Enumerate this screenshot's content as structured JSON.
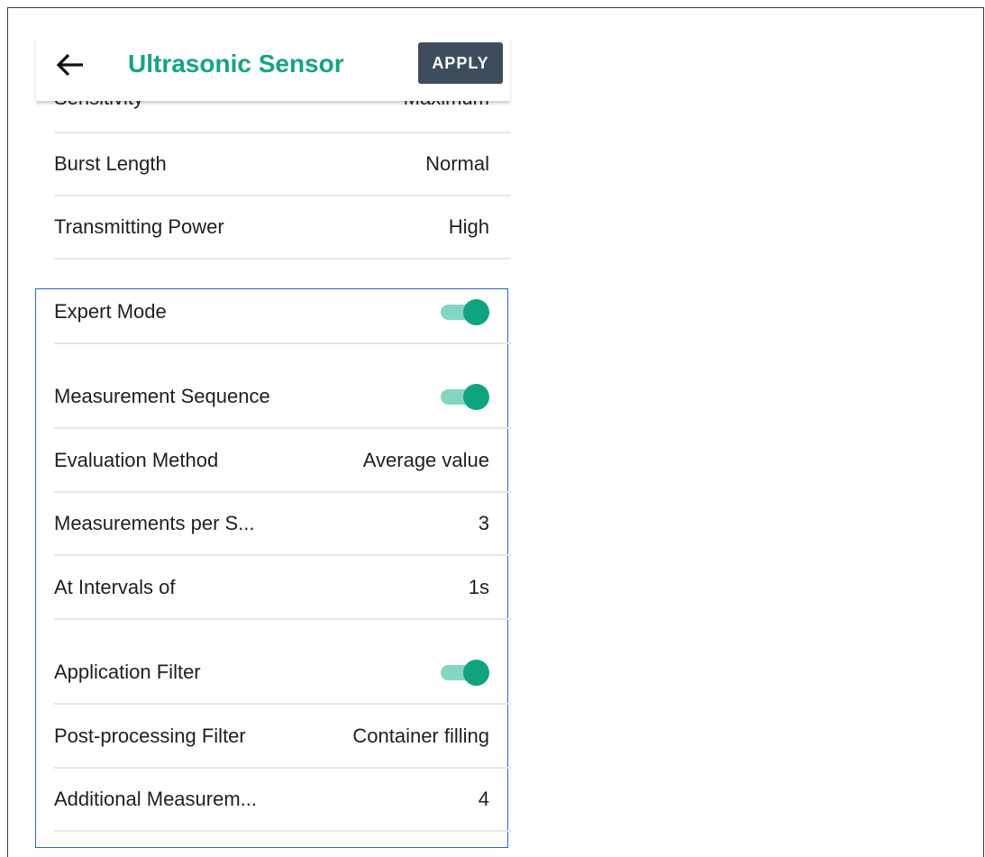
{
  "header": {
    "title": "Ultrasonic Sensor",
    "apply_label": "APPLY",
    "back_icon": "arrow-left-icon",
    "title_color": "#16a383",
    "apply_bg": "#3d4d5c"
  },
  "settings": {
    "partial_row": {
      "label": "Sensitivity",
      "value": "Maximum"
    },
    "burst_length": {
      "label": "Burst Length",
      "value": "Normal"
    },
    "transmitting_power": {
      "label": "Transmitting Power",
      "value": "High"
    }
  },
  "expert": {
    "expert_mode": {
      "label": "Expert Mode",
      "enabled": true
    },
    "measurement_sequence": {
      "label": "Measurement Sequence",
      "enabled": true
    },
    "evaluation_method": {
      "label": "Evaluation Method",
      "value": "Average value"
    },
    "measurements_per": {
      "label": "Measurements per S...",
      "value": "3"
    },
    "intervals": {
      "label": "At Intervals of",
      "value": "1s"
    },
    "application_filter": {
      "label": "Application Filter",
      "enabled": true
    },
    "post_processing": {
      "label": "Post-processing Filter",
      "value": "Container filling"
    },
    "additional": {
      "label": "Additional Measurem...",
      "value": "4"
    }
  },
  "colors": {
    "toggle_on_thumb": "#10a37f",
    "toggle_on_track": "#84d6c2",
    "highlight_border": "#2f5fcf"
  }
}
